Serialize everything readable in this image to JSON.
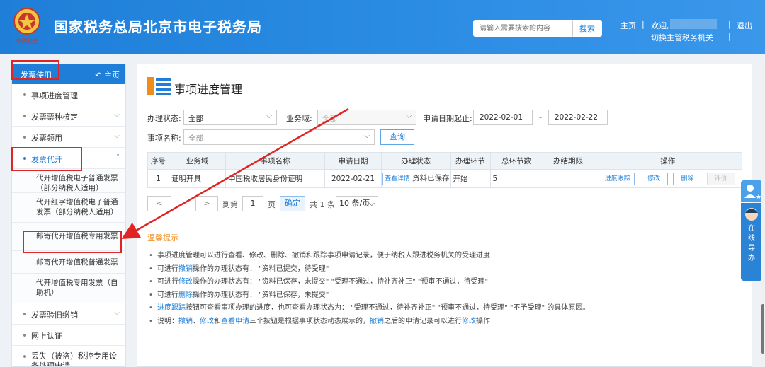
{
  "header": {
    "title": "国家税务总局北京市电子税务局",
    "search_placeholder": "请输入需要搜索的内容",
    "search_button": "搜索",
    "home_link": "主页",
    "welcome": "欢迎,",
    "switch_org": "切换主管税务机关",
    "logout": "退出",
    "separator": "|",
    "emblem_text": "中国税务"
  },
  "sidebar": {
    "title": "发票使用",
    "home": "主页",
    "items": [
      {
        "label": "事项进度管理"
      },
      {
        "label": "发票票种核定"
      },
      {
        "label": "发票领用"
      },
      {
        "label": "发票代开"
      }
    ],
    "sub_items": [
      {
        "label": "代开增值税电子普通发票（部分纳税人适用）"
      },
      {
        "label": "代开红字增值税电子普通发票（部分纳税人适用）"
      },
      {
        "label": "邮寄代开增值税专用发票"
      },
      {
        "label": "邮寄代开增值税普通发票"
      },
      {
        "label": "代开增值税专用发票（自助机）"
      }
    ],
    "items_after": [
      {
        "label": "发票验旧缴销"
      },
      {
        "label": "网上认证"
      },
      {
        "label": "丢失（被盗）税控专用设备处理申请"
      }
    ]
  },
  "main": {
    "title": "事项进度管理",
    "filters": {
      "status_label": "办理状态:",
      "status_value": "全部",
      "domain_label": "业务域:",
      "domain_value": "全部",
      "date_label": "申请日期起止:",
      "date_from": "2022-02-01",
      "date_sep": "-",
      "date_to": "2022-02-22",
      "item_label": "事项名称:",
      "item_value": "全部",
      "query_button": "查询"
    },
    "table": {
      "headers": [
        "序号",
        "业务域",
        "事项名称",
        "申请日期",
        "办理状态",
        "办理环节",
        "总环节数",
        "办结期限",
        "操作"
      ],
      "rows": [
        {
          "index": "1",
          "domain": "证明开具",
          "name": "中国税收居民身份证明",
          "date": "2022-02-21",
          "status_btn": "查看详情",
          "status": "资料已保存",
          "step": "开始",
          "total": "5",
          "deadline": "",
          "ops": [
            "进度跟踪",
            "修改",
            "删除",
            "评价"
          ]
        }
      ]
    },
    "pager": {
      "prev": "<",
      "next": ">",
      "goto": "到第",
      "page_value": "1",
      "page_unit": "页",
      "confirm": "确定",
      "total": "共 1 条",
      "page_size": "10 条/页"
    },
    "tips_title": "温馨提示",
    "tips": {
      "t1": "事项进度管理可以进行查看、修改、删除、撤销和跟踪事项申请记录，便于纳税人跟进税务机关的受理进度",
      "t2a": "可进行",
      "t2link": "撤销",
      "t2b": "操作的办理状态有：  \"资料已提交，待受理\"",
      "t3a": "可进行",
      "t3link": "修改",
      "t3b": "操作的办理状态有：  \"资料已保存，未提交\"   \"受理不通过，待补齐补正\"   \"预审不通过，待受理\"",
      "t4a": "可进行",
      "t4link": "删除",
      "t4b": "操作的办理状态有：  \"资料已保存，未提交\"",
      "t5link": "进度跟踪",
      "t5b": "按钮可查看事项办理的进度，也可查看办理状态为：  \"受理不通过，待补齐补正\"   \"预审不通过，待受理\"   \"不予受理\"  的具体原因。",
      "t6a": "说明：",
      "t6l1": "撤销",
      "t6s1": "、",
      "t6l2": "修改",
      "t6s2": "和",
      "t6l3": "查看申请",
      "t6b": "三个按钮是根据事项状态动态展示的，",
      "t6l4": "撤销",
      "t6c": "之后的申请记录可以进行",
      "t6l5": "修改",
      "t6d": "操作"
    }
  },
  "float_bar": {
    "label": "在线导办"
  },
  "colors": {
    "brand": "#1f7fd8",
    "highlight": "#e02424",
    "tip": "#f08c1c"
  }
}
